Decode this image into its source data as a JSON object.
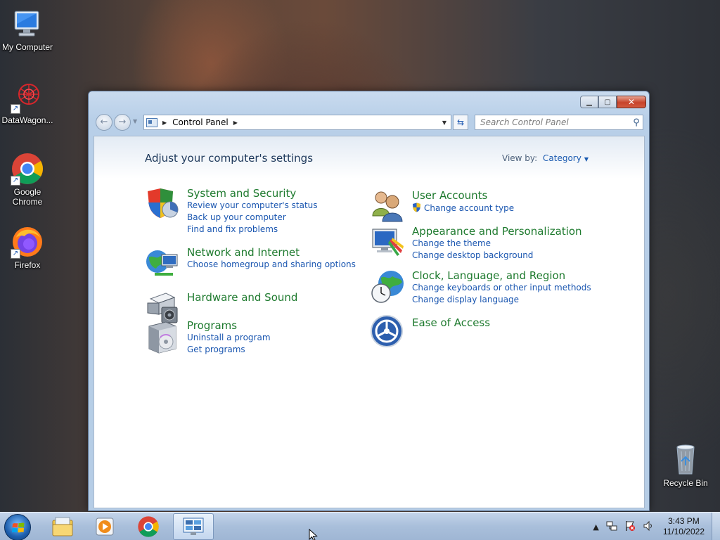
{
  "desktop": {
    "icons": [
      {
        "label": "My Computer",
        "icon": "computer-icon"
      },
      {
        "label": "DataWagon...",
        "icon": "datawagon-icon"
      },
      {
        "label": "Google Chrome",
        "icon": "chrome-icon"
      },
      {
        "label": "Firefox",
        "icon": "firefox-icon"
      },
      {
        "label": "Recycle Bin",
        "icon": "recycle-bin-icon"
      }
    ]
  },
  "window": {
    "breadcrumb": "Control Panel",
    "search_placeholder": "Search Control Panel",
    "page_title": "Adjust your computer's settings",
    "view_by_label": "View by:",
    "view_by_value": "Category",
    "categories_left": [
      {
        "title": "System and Security",
        "icon": "shield-icon",
        "links": [
          "Review your computer's status",
          "Back up your computer",
          "Find and fix problems"
        ]
      },
      {
        "title": "Network and Internet",
        "icon": "network-globe-icon",
        "links": [
          "Choose homegroup and sharing options"
        ]
      },
      {
        "title": "Hardware and Sound",
        "icon": "printer-icon",
        "links": []
      },
      {
        "title": "Programs",
        "icon": "programs-icon",
        "links": [
          "Uninstall a program",
          "Get programs"
        ]
      }
    ],
    "categories_right": [
      {
        "title": "User Accounts",
        "icon": "users-icon",
        "links": [
          "Change account type"
        ]
      },
      {
        "title": "Appearance and Personalization",
        "icon": "monitor-paint-icon",
        "links": [
          "Change the theme",
          "Change desktop background"
        ]
      },
      {
        "title": "Clock, Language, and Region",
        "icon": "globe-clock-icon",
        "links": [
          "Change keyboards or other input methods",
          "Change display language"
        ]
      },
      {
        "title": "Ease of Access",
        "icon": "ease-of-access-icon",
        "links": []
      }
    ]
  },
  "taskbar": {
    "time": "3:43 PM",
    "date": "11/10/2022",
    "pinned": [
      "explorer-icon",
      "media-player-icon",
      "chrome-icon",
      "control-panel-icon"
    ]
  },
  "colors": {
    "category_title": "#1e7a2e",
    "link": "#1a56b0",
    "heading": "#1e395b"
  }
}
